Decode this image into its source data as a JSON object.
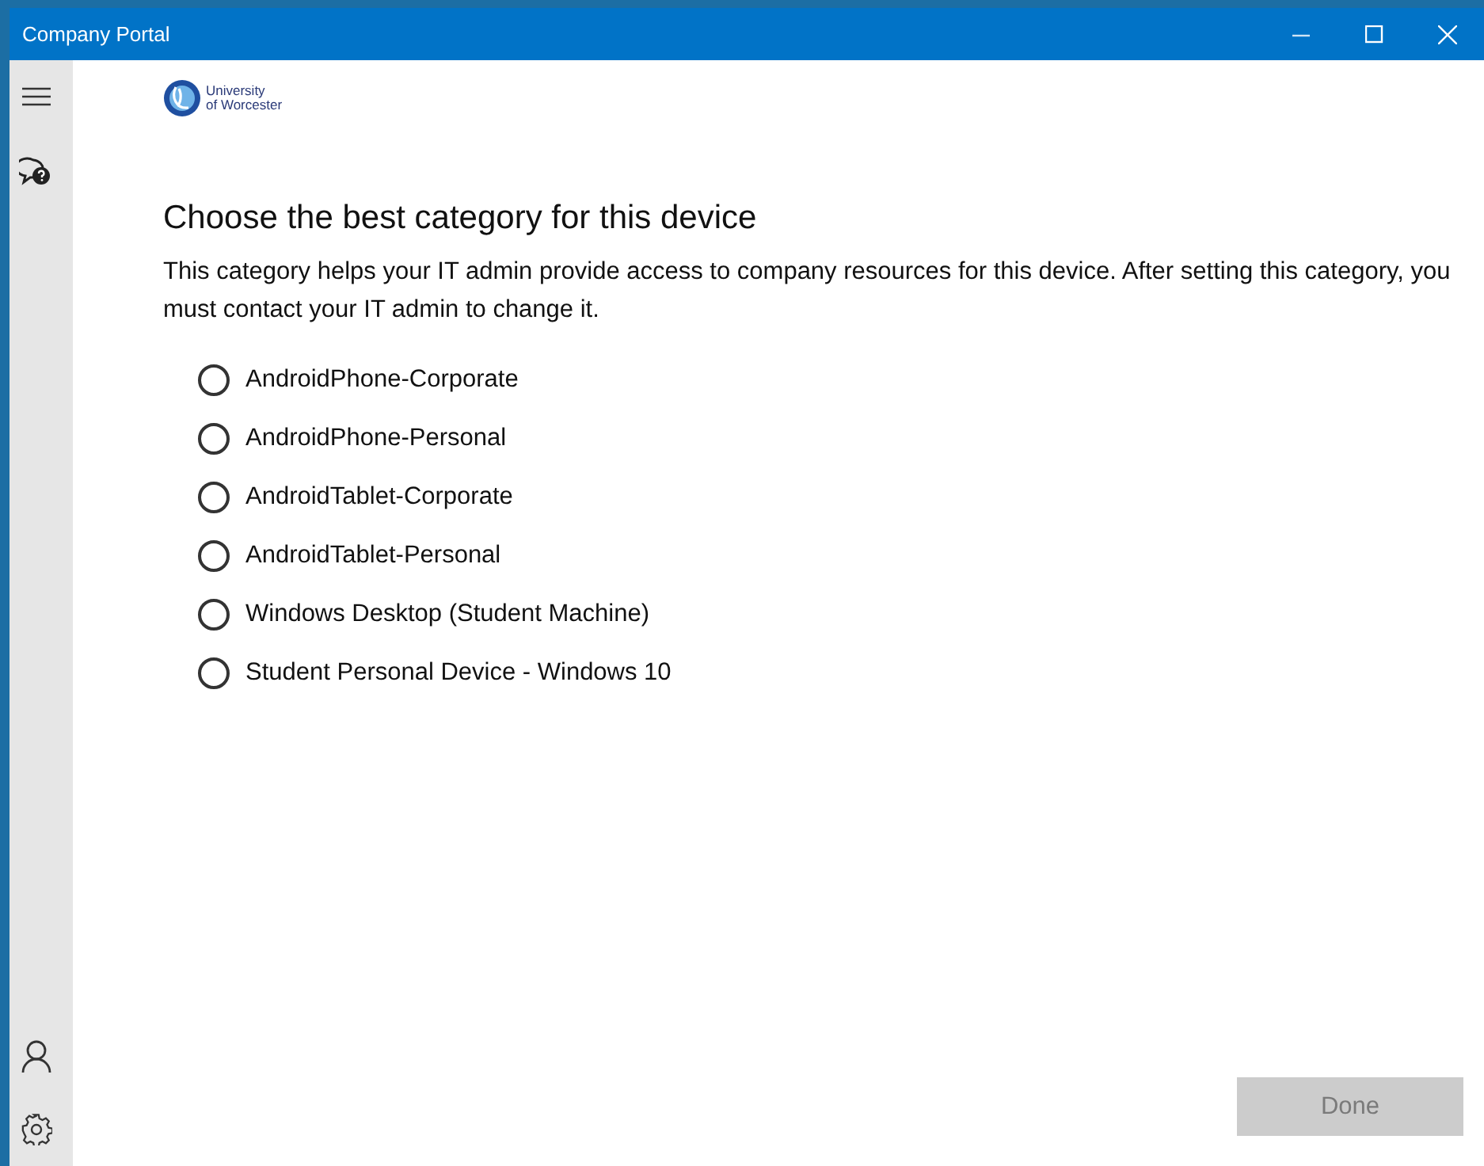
{
  "window": {
    "title": "Company Portal"
  },
  "logo": {
    "lines": [
      "University",
      "of Worcester"
    ]
  },
  "heading": "Choose the best category for this device",
  "description": "This category helps your IT admin provide access to company resources for this device. After setting this category, you must contact your IT admin to change it.",
  "options": [
    {
      "label": "AndroidPhone-Corporate",
      "selected": false
    },
    {
      "label": "AndroidPhone-Personal",
      "selected": false
    },
    {
      "label": "AndroidTablet-Corporate",
      "selected": false
    },
    {
      "label": "AndroidTablet-Personal",
      "selected": false
    },
    {
      "label": "Windows Desktop (Student Machine)",
      "selected": false
    },
    {
      "label": "Student Personal Device - Windows 10",
      "selected": false
    }
  ],
  "done_button": {
    "label": "Done",
    "disabled": true
  }
}
